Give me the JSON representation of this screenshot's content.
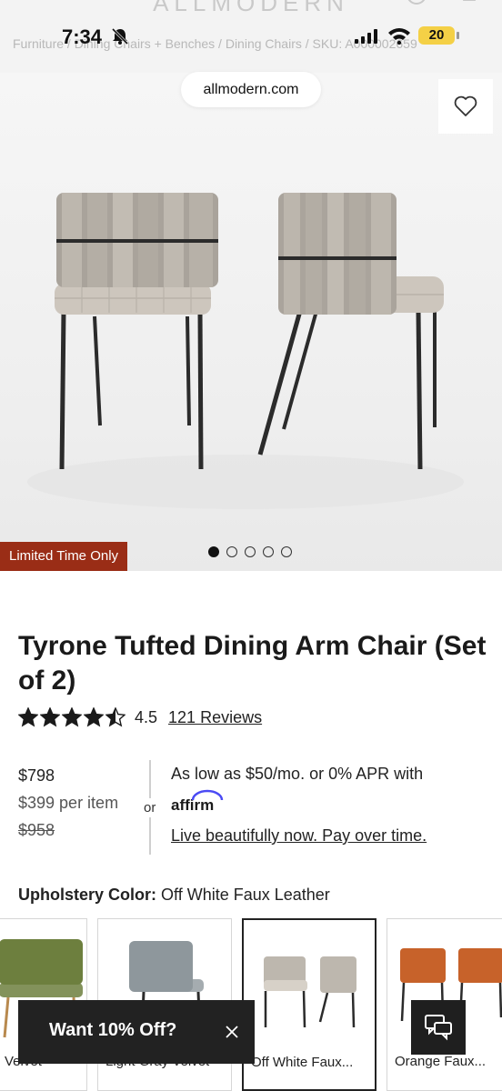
{
  "status_bar": {
    "time": "7:34",
    "battery": "20"
  },
  "site_header": {
    "logo_text": "ALLMODERN",
    "breadcrumb": "Furniture  /  Dining Chairs + Benches  /  Dining Chairs  /  SKU: A000002659"
  },
  "browser": {
    "url": "allmodern.com"
  },
  "gallery": {
    "badge": "Limited Time Only",
    "image_count": 5,
    "active_index": 0
  },
  "product": {
    "title": "Tyrone Tufted Dining Arm Chair (Set of 2)",
    "rating": 4.5,
    "rating_text": "4.5",
    "reviews_text": "121 Reviews",
    "price": "$798",
    "per_item": "$399 per item",
    "original_price": "$958"
  },
  "financing": {
    "or_label": "or",
    "monthly_text": "As low as $50/mo. or 0% APR with",
    "provider": "affirm",
    "link_text": "Live beautifully now. Pay over time."
  },
  "upholstery": {
    "label": "Upholstery Color:",
    "selected": "Off White Faux Leather",
    "swatches": [
      {
        "label": "Velvet",
        "color": "#6d7f3e"
      },
      {
        "label": "Light Gray Velvet",
        "color": "#8e979c"
      },
      {
        "label": "Off White Faux...",
        "color": "#bdb7ae"
      },
      {
        "label": "Orange Faux...",
        "color": "#c7622a"
      }
    ]
  },
  "promo": {
    "text": "Want 10% Off?"
  },
  "colors": {
    "badge_bg": "#9a2d16",
    "toast_bg": "#222222",
    "battery": "#f4d046"
  }
}
